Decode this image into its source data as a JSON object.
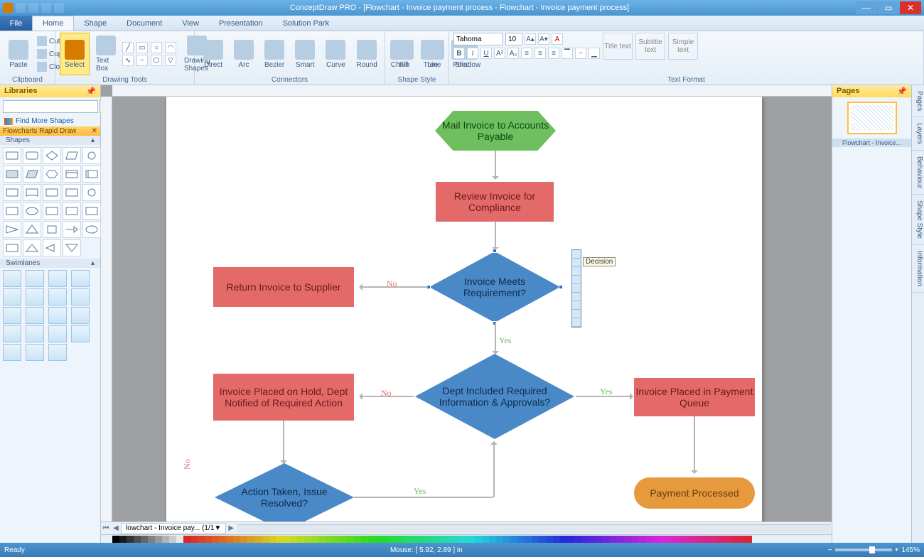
{
  "app": {
    "title": "ConceptDraw PRO - [Flowchart - Invoice payment process - Flowchart - Invoice payment process]"
  },
  "tabs": {
    "file": "File",
    "list": [
      "Home",
      "Shape",
      "Document",
      "View",
      "Presentation",
      "Solution Park"
    ],
    "active": 0
  },
  "ribbon": {
    "clipboard": {
      "paste": "Paste",
      "cut": "Cut",
      "copy": "Copy",
      "clone": "Clone",
      "label": "Clipboard"
    },
    "drawing": {
      "select": "Select",
      "textbox": "Text Box",
      "shapes": "Drawing Shapes",
      "label": "Drawing Tools"
    },
    "connectors": {
      "direct": "Direct",
      "arc": "Arc",
      "bezier": "Bezier",
      "smart": "Smart",
      "curve": "Curve",
      "round": "Round",
      "chain": "Chain",
      "tree": "Tree",
      "point": "Point",
      "label": "Connectors"
    },
    "shapestyle": {
      "fill": "Fill",
      "line": "Line",
      "shadow": "Shadow",
      "label": "Shape Style"
    },
    "textformat": {
      "font": "Tahoma",
      "size": "10",
      "label": "Text Format",
      "title": "Title text",
      "subtitle": "Subtitle text",
      "simple": "Simple text"
    }
  },
  "leftpanel": {
    "title": "Libraries",
    "findmore": "Find More Shapes",
    "lib1": "Flowcharts Rapid Draw",
    "shapes": "Shapes",
    "swimlanes": "Swimlanes"
  },
  "rightpanel": {
    "title": "Pages",
    "thumb": "Flowchart - Invoice...",
    "sidetabs": [
      "Pages",
      "Layers",
      "Behaviour",
      "Shape Style",
      "Information"
    ]
  },
  "flowchart": {
    "n1": "Mail Invoice to Accounts Payable",
    "n2": "Review Invoice for Compliance",
    "n3": "Invoice Meets Requirement?",
    "n4": "Return Invoice to Supplier",
    "n5": "Dept Included Required Information & Approvals?",
    "n6": "Invoice Placed on Hold, Dept Notified of Required Action",
    "n7": "Invoice Placed in Payment Queue",
    "n8": "Action Taken, Issue Resolved?",
    "n9": "Payment Processed",
    "yes": "Yes",
    "no": "No",
    "tooltip": "Decision"
  },
  "pagetab": {
    "name": "lowchart - Invoice pay... (1/1"
  },
  "status": {
    "ready": "Ready",
    "mouse": "Mouse: [ 5.92, 2.89 ] in",
    "zoom": "145%"
  }
}
